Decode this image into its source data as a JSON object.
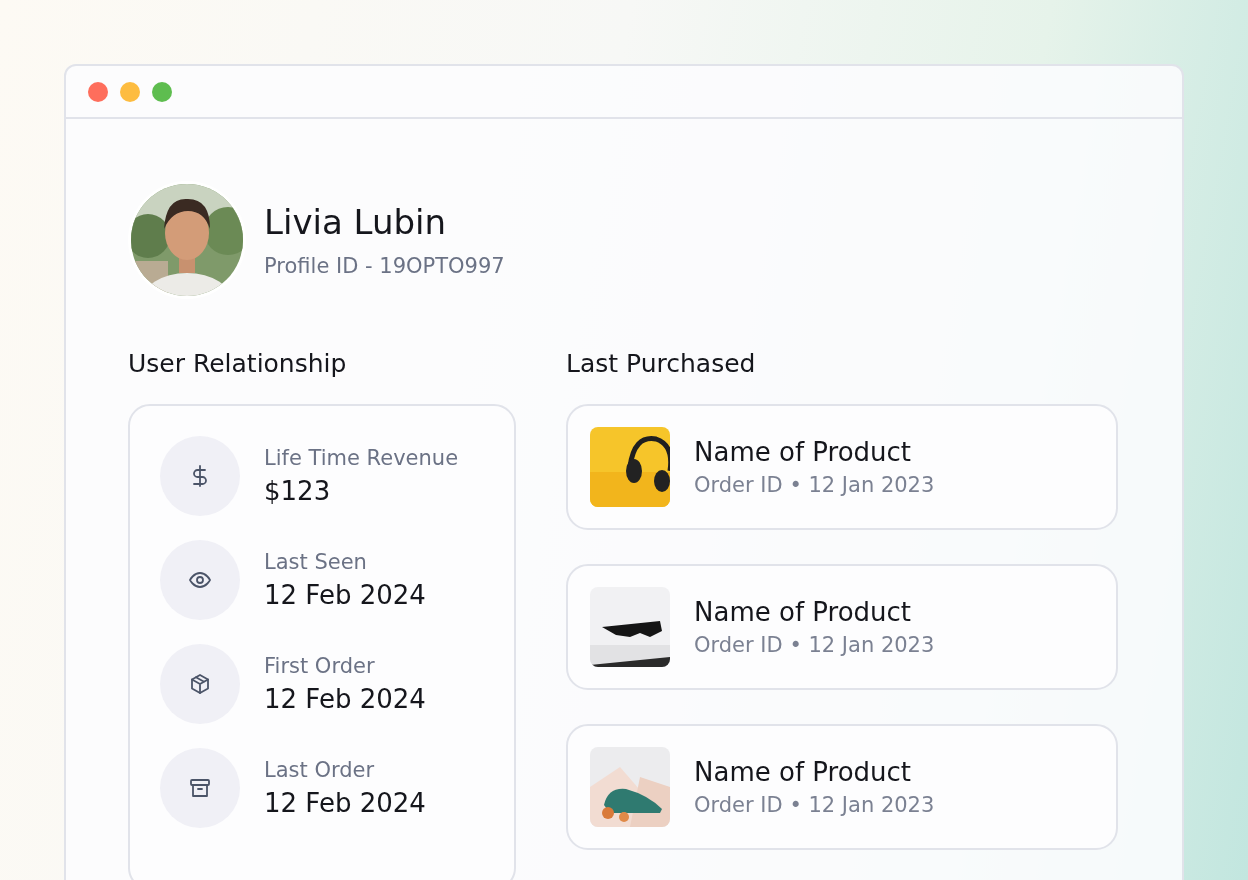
{
  "window": {
    "controls": [
      {
        "color": "#fe6e5c"
      },
      {
        "color": "#fdbc40"
      },
      {
        "color": "#5ebd4f"
      }
    ]
  },
  "profile": {
    "name": "Livia Lubin",
    "profile_id": "Profile ID - 19OPTO997"
  },
  "user_relationship": {
    "title": "User Relationship",
    "stats": [
      {
        "label": "Life Time Revenue",
        "value": "$123"
      },
      {
        "label": "Last Seen",
        "value": "12 Feb 2024"
      },
      {
        "label": "First Order",
        "value": "12 Feb 2024"
      },
      {
        "label": "Last Order",
        "value": "12 Feb 2024"
      }
    ]
  },
  "last_purchased": {
    "title": "Last Purchased",
    "items": [
      {
        "name": "Name of Product",
        "meta": "Order ID • 12 Jan 2023"
      },
      {
        "name": "Name of Product",
        "meta": "Order ID • 12 Jan 2023"
      },
      {
        "name": "Name of Product",
        "meta": "Order ID • 12 Jan 2023"
      }
    ]
  }
}
